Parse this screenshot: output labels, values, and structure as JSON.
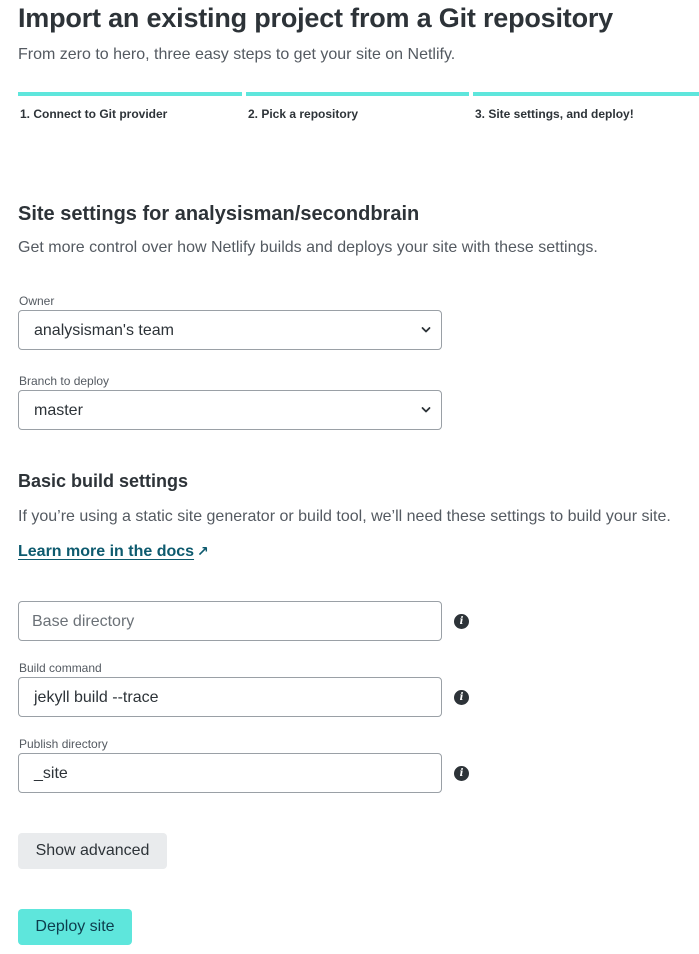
{
  "page": {
    "title": "Import an existing project from a Git repository",
    "subtitle": "From zero to hero, three easy steps to get your site on Netlify."
  },
  "steps": [
    {
      "label": "1. Connect to Git provider"
    },
    {
      "label": "2. Pick a repository"
    },
    {
      "label": "3. Site settings, and deploy!"
    }
  ],
  "site_settings": {
    "title": "Site settings for analysisman/secondbrain",
    "description": "Get more control over how Netlify builds and deploys your site with these settings.",
    "owner": {
      "label": "Owner",
      "value": "analysisman's team"
    },
    "branch": {
      "label": "Branch to deploy",
      "value": "master"
    }
  },
  "build_settings": {
    "title": "Basic build settings",
    "description": "If you’re using a static site generator or build tool, we’ll need these settings to build your site.",
    "docs_link": "Learn more in the docs",
    "base_directory": {
      "placeholder": "Base directory",
      "value": ""
    },
    "build_command": {
      "label": "Build command",
      "value": "jekyll build --trace"
    },
    "publish_directory": {
      "label": "Publish directory",
      "value": "_site"
    }
  },
  "actions": {
    "show_advanced": "Show advanced",
    "deploy": "Deploy site"
  },
  "colors": {
    "accent": "#5ee6dc",
    "link": "#0d5a6e",
    "text": "#2d3338"
  }
}
